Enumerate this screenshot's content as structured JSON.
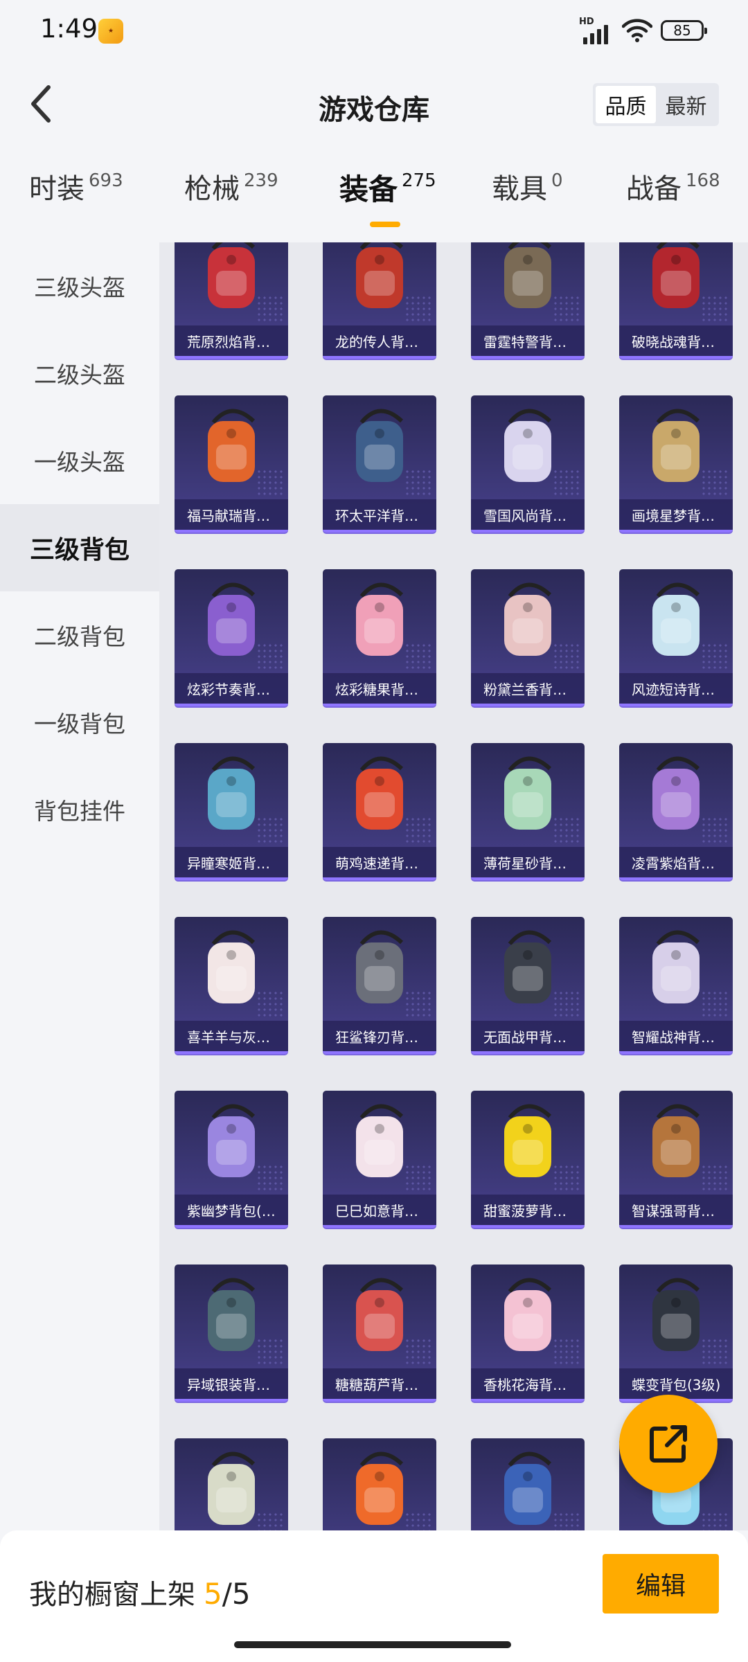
{
  "status": {
    "time": "1:49",
    "app_icon": "game-app-icon",
    "network": "HD",
    "battery": "85"
  },
  "header": {
    "title": "游戏仓库",
    "sort_options": [
      "品质",
      "最新"
    ],
    "sort_active": "品质"
  },
  "categories": [
    {
      "label": "时装",
      "count": "693"
    },
    {
      "label": "枪械",
      "count": "239"
    },
    {
      "label": "装备",
      "count": "275",
      "active": true
    },
    {
      "label": "载具",
      "count": "0"
    },
    {
      "label": "战备",
      "count": "168"
    }
  ],
  "sidemenu": [
    {
      "label": "三级头盔"
    },
    {
      "label": "二级头盔"
    },
    {
      "label": "一级头盔"
    },
    {
      "label": "三级背包",
      "active": true
    },
    {
      "label": "二级背包"
    },
    {
      "label": "一级背包"
    },
    {
      "label": "背包挂件"
    }
  ],
  "items": [
    {
      "name": "荒原烈焰背…",
      "color": "#c8323a"
    },
    {
      "name": "龙的传人背…",
      "color": "#c0392b"
    },
    {
      "name": "雷霆特警背…",
      "color": "#7a6a55"
    },
    {
      "name": "破晓战魂背…",
      "color": "#b3262e"
    },
    {
      "name": "福马献瑞背…",
      "color": "#e2652b"
    },
    {
      "name": "环太平洋背…",
      "color": "#3e5f8c"
    },
    {
      "name": "雪国风尚背…",
      "color": "#d9d4ee"
    },
    {
      "name": "画境星梦背…",
      "color": "#c9a86a"
    },
    {
      "name": "炫彩节奏背…",
      "color": "#8a5fcf"
    },
    {
      "name": "炫彩糖果背…",
      "color": "#f0a0b8"
    },
    {
      "name": "粉黛兰香背…",
      "color": "#e8c3c3"
    },
    {
      "name": "风迹短诗背…",
      "color": "#c9e4f0"
    },
    {
      "name": "异瞳寒姬背…",
      "color": "#5aa7c8"
    },
    {
      "name": "萌鸡速递背…",
      "color": "#e24b2f"
    },
    {
      "name": "薄荷星砂背…",
      "color": "#a8d8b8"
    },
    {
      "name": "凌霄紫焰背…",
      "color": "#a57ad6"
    },
    {
      "name": "喜羊羊与灰…",
      "color": "#f2e6e6"
    },
    {
      "name": "狂鲨锋刃背…",
      "color": "#6b6f7a"
    },
    {
      "name": "无面战甲背…",
      "color": "#3a3f4a"
    },
    {
      "name": "智耀战神背…",
      "color": "#d7cfe9"
    },
    {
      "name": "紫幽梦背包(…",
      "color": "#9a86e0"
    },
    {
      "name": "巳巳如意背…",
      "color": "#f3e2ea"
    },
    {
      "name": "甜蜜菠萝背…",
      "color": "#f2d21b"
    },
    {
      "name": "智谋强哥背…",
      "color": "#b5753c"
    },
    {
      "name": "异域银装背…",
      "color": "#4d6a74"
    },
    {
      "name": "糖糖葫芦背…",
      "color": "#d9534f"
    },
    {
      "name": "香桃花海背…",
      "color": "#f4c2d3"
    },
    {
      "name": "蝶变背包(3级)",
      "color": "#2f3540"
    },
    {
      "name": "",
      "color": "#d8dbc8"
    },
    {
      "name": "",
      "color": "#ef6a2a"
    },
    {
      "name": "",
      "color": "#3b63b8"
    },
    {
      "name": "",
      "color": "#8fd6f0"
    }
  ],
  "bottom": {
    "showcase_label": "我的橱窗上架",
    "current": "5",
    "separator": "/",
    "total": "5",
    "edit_label": "编辑"
  },
  "accent": "#ffab00"
}
